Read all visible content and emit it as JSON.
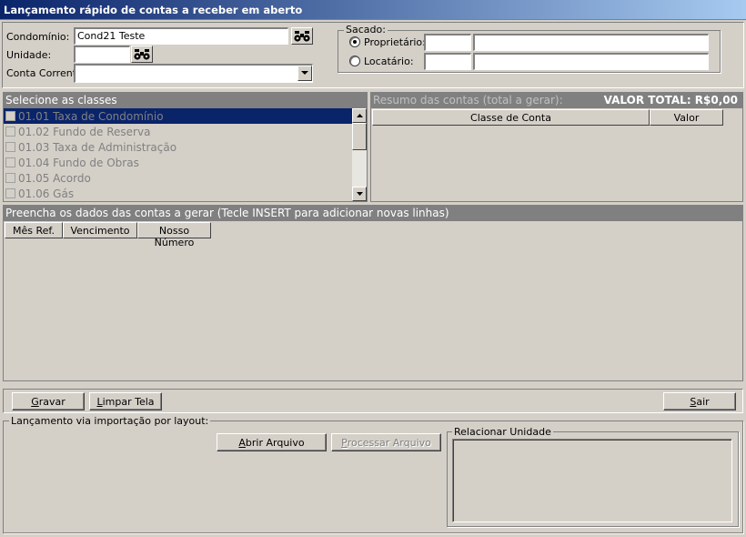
{
  "window": {
    "title": "Lançamento rápido de contas a receber em aberto"
  },
  "form": {
    "condominio_label": "Condomínio:",
    "condominio_value": "Cond21 Teste",
    "unidade_label": "Unidade:",
    "unidade_value": "",
    "conta_corrente_label": "Conta Corrente:",
    "conta_corrente_value": ""
  },
  "sacado": {
    "legend": "Sacado:",
    "options": [
      {
        "label": "Proprietário:",
        "selected": true
      },
      {
        "label": "Locatário:",
        "selected": false
      }
    ]
  },
  "classes": {
    "header": "Selecione as classes",
    "items": [
      {
        "label": "01.01 Taxa de Condomínio",
        "selected": true
      },
      {
        "label": "01.02 Fundo de Reserva",
        "selected": false
      },
      {
        "label": "01.03 Taxa de Administração",
        "selected": false
      },
      {
        "label": "01.04 Fundo de Obras",
        "selected": false
      },
      {
        "label": "01.05 Acordo",
        "selected": false
      },
      {
        "label": "01.06 Gás",
        "selected": false
      }
    ]
  },
  "resumo": {
    "header": "Resumo das contas (total a gerar):",
    "total_label": "VALOR TOTAL: R$0,00",
    "columns": [
      "Classe de Conta",
      "Valor"
    ]
  },
  "dados": {
    "header": "Preencha os dados das contas a gerar (Tecle INSERT para adicionar novas linhas)",
    "columns": [
      "Mês Ref.",
      "Vencimento",
      "Nosso Número"
    ]
  },
  "buttons": {
    "gravar_accel": "G",
    "gravar_rest": "ravar",
    "limpar_accel": "L",
    "limpar_rest": "impar Tela",
    "sair_accel": "S",
    "sair_rest": "air",
    "abrir_accel": "A",
    "abrir_rest": "brir Arquivo",
    "processar_accel": "P",
    "processar_rest": "rocessar Arquivo"
  },
  "importacao": {
    "legend": "Lançamento via importação por layout:",
    "relacionar_legend": "Relacionar Unidade"
  },
  "icons": {
    "binoculars": "binoculars-icon",
    "dropdown": "chevron-down-icon",
    "scroll_up": "arrow-up-icon",
    "scroll_down": "arrow-down-icon"
  },
  "colors": {
    "title_start": "#0a246a",
    "title_end": "#a6caf0",
    "selection": "#0a246a",
    "header_bg": "#808080",
    "face": "#d4d0c8"
  }
}
